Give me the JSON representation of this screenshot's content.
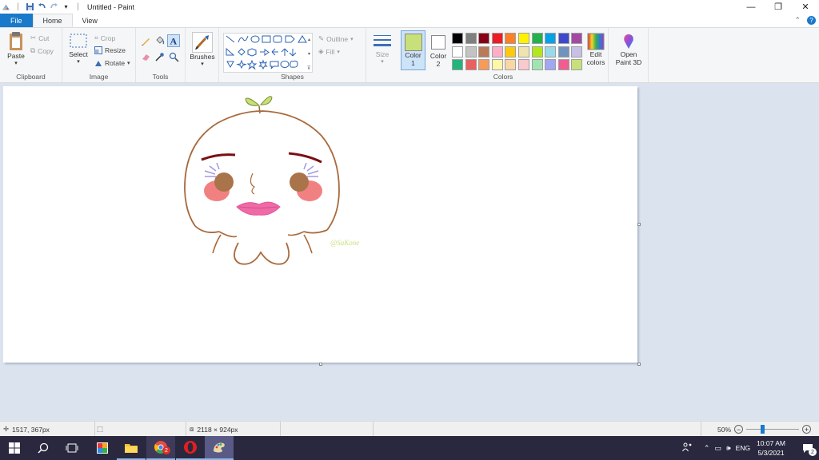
{
  "window": {
    "title": "Untitled - Paint",
    "controls": {
      "minimize": "—",
      "restore": "❐",
      "close": "✕"
    }
  },
  "tabs": [
    {
      "label": "File"
    },
    {
      "label": "Home"
    },
    {
      "label": "View"
    }
  ],
  "ribbon": {
    "clipboard": {
      "label": "Clipboard",
      "paste": "Paste",
      "cut": "Cut",
      "copy": "Copy"
    },
    "image": {
      "label": "Image",
      "select": "Select",
      "crop": "Crop",
      "resize": "Resize",
      "rotate": "Rotate"
    },
    "tools": {
      "label": "Tools"
    },
    "brushes": {
      "label": "Brushes"
    },
    "shapes": {
      "label": "Shapes",
      "outline": "Outline",
      "fill": "Fill"
    },
    "size": {
      "label": "Size"
    },
    "color1": {
      "line1": "Color",
      "line2": "1",
      "value": "#c8e07a"
    },
    "color2": {
      "line1": "Color",
      "line2": "2",
      "value": "#ffffff"
    },
    "colors": {
      "label": "Colors",
      "row1": [
        "#000000",
        "#7f7f7f",
        "#880015",
        "#ed1c24",
        "#ff7f27",
        "#fff200",
        "#22b14c",
        "#00a2e8",
        "#3f48cc",
        "#a349a4"
      ],
      "row2": [
        "#ffffff",
        "#c3c3c3",
        "#b97a57",
        "#ffaec9",
        "#ffc90e",
        "#efe4b0",
        "#b5e61d",
        "#99d9ea",
        "#7092be",
        "#c8bfe7"
      ],
      "row3": [
        "#22b47c",
        "#e8605f",
        "#f79a5a",
        "#fef6a8",
        "#fad6a5",
        "#f9c9ce",
        "#a2e4b0",
        "#a3a6f0",
        "#ef5e8e",
        "#c8e07a"
      ]
    },
    "edit_colors": {
      "line1": "Edit",
      "line2": "colors"
    },
    "paint3d": {
      "line1": "Open",
      "line2": "Paint 3D"
    }
  },
  "canvas": {
    "signature": "@SaKone"
  },
  "status": {
    "cursor_pos": "1517, 367px",
    "image_size": "2118 × 924px",
    "zoom": "50%",
    "zoom_fraction": 0.3
  },
  "taskbar": {
    "language": "ENG",
    "time": "10:07 AM",
    "date": "5/3/2021",
    "chrome_badge": "2",
    "notification_count": "2"
  }
}
